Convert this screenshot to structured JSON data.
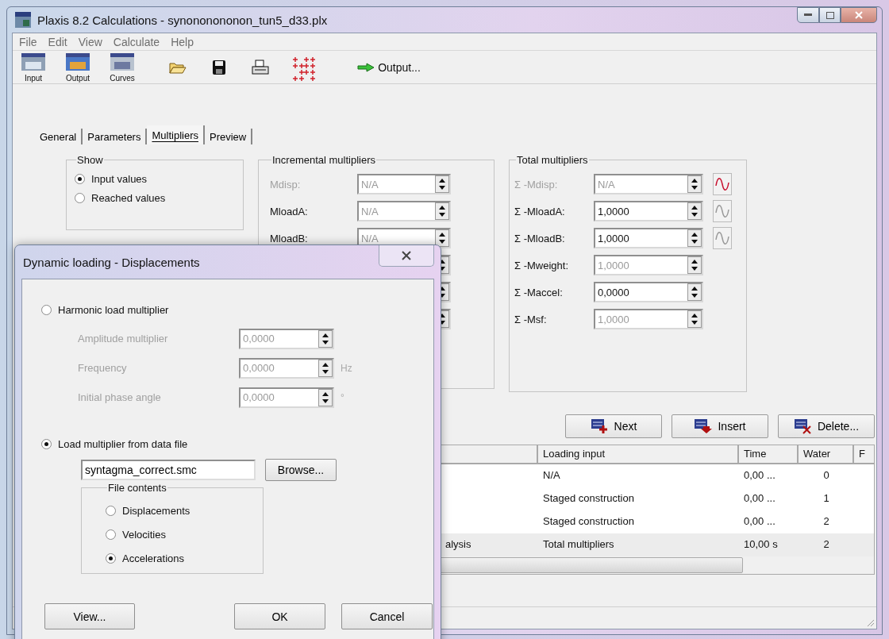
{
  "window": {
    "title": "Plaxis 8.2 Calculations - synononononon_tun5_d33.plx"
  },
  "menu": [
    "File",
    "Edit",
    "View",
    "Calculate",
    "Help"
  ],
  "toolbar": [
    {
      "kind": "input",
      "label": "Input"
    },
    {
      "kind": "output",
      "label": "Output"
    },
    {
      "kind": "curves",
      "label": "Curves"
    },
    {
      "kind": "open"
    },
    {
      "kind": "save"
    },
    {
      "kind": "print"
    },
    {
      "kind": "points"
    },
    {
      "kind": "output_link",
      "label": "Output..."
    }
  ],
  "tabs": [
    {
      "label": "General",
      "selected": false
    },
    {
      "label": "Parameters",
      "selected": false
    },
    {
      "label": "Multipliers",
      "selected": true
    },
    {
      "label": "Preview",
      "selected": false
    }
  ],
  "show_group": {
    "title": "Show",
    "options": [
      {
        "label": "Input values",
        "selected": true
      },
      {
        "label": "Reached values",
        "selected": false
      }
    ]
  },
  "incremental": {
    "title": "Incremental multipliers",
    "rows": [
      {
        "kind": "field",
        "label": "Mdisp:",
        "value": "N/A",
        "disabled": true
      },
      {
        "kind": "field",
        "label": "MloadA:",
        "value": "N/A",
        "disabled": false
      },
      {
        "kind": "field",
        "label": "MloadB:",
        "value": "N/A",
        "disabled": false
      },
      {
        "kind": "covered"
      },
      {
        "kind": "covered"
      },
      {
        "kind": "covered"
      }
    ]
  },
  "total": {
    "title": "Total multipliers",
    "rows": [
      {
        "label": "Σ -Mdisp:",
        "value": "N/A",
        "disabled": true,
        "read_only": true,
        "wave": {
          "active": true
        }
      },
      {
        "label": "Σ -MloadA:",
        "value": "1,0000",
        "disabled": false,
        "read_only": false,
        "wave": {
          "active": false
        }
      },
      {
        "label": "Σ -MloadB:",
        "value": "1,0000",
        "disabled": false,
        "read_only": false,
        "wave": {
          "active": false
        }
      },
      {
        "label": "Σ -Mweight:",
        "value": "1,0000",
        "disabled": false,
        "read_only": true
      },
      {
        "label": "Σ -Maccel:",
        "value": "0,0000",
        "disabled": false,
        "read_only": false
      },
      {
        "label": "Σ -Msf:",
        "value": "1,0000",
        "disabled": false,
        "read_only": true
      }
    ]
  },
  "actions": [
    {
      "kind": "next",
      "label": "Next"
    },
    {
      "kind": "insert",
      "label": "Insert"
    },
    {
      "kind": "delete",
      "label": "Delete..."
    }
  ],
  "table": {
    "columns": [
      "Loading input",
      "Time",
      "Water",
      "F"
    ],
    "rows": [
      {
        "loading_input": "N/A",
        "time": "0,00 ...",
        "water": "0",
        "selected": false
      },
      {
        "loading_input": "Staged construction",
        "time": "0,00 ...",
        "water": "1",
        "selected": false
      },
      {
        "loading_input": "Staged construction",
        "time": "0,00 ...",
        "water": "2",
        "selected": false
      },
      {
        "column_1": "alysis",
        "loading_input": "Total multipliers",
        "time": "10,00 s",
        "water": "2",
        "selected": true
      }
    ]
  },
  "dialog": {
    "title": "Dynamic loading - Displacements",
    "harmonic": {
      "label": "Harmonic load multiplier",
      "selected": false,
      "fields": [
        {
          "label": "Amplitude multiplier",
          "value": "0,0000"
        },
        {
          "label": "Frequency",
          "value": "0,0000",
          "unit": "Hz"
        },
        {
          "label": "Initial phase angle",
          "value": "0,0000",
          "unit": "°"
        }
      ]
    },
    "from_file": {
      "label": "Load multiplier from data file",
      "selected": true,
      "file": "syntagma_correct.smc",
      "browse": "Browse...",
      "contents": {
        "title": "File contents",
        "options": [
          {
            "label": "Displacements",
            "selected": false
          },
          {
            "label": "Velocities",
            "selected": false
          },
          {
            "label": "Accelerations",
            "selected": true
          }
        ]
      }
    },
    "buttons": [
      {
        "kind": "view",
        "label": "View..."
      },
      {
        "kind": "ok",
        "label": "OK"
      },
      {
        "kind": "cancel",
        "label": "Cancel"
      }
    ]
  }
}
